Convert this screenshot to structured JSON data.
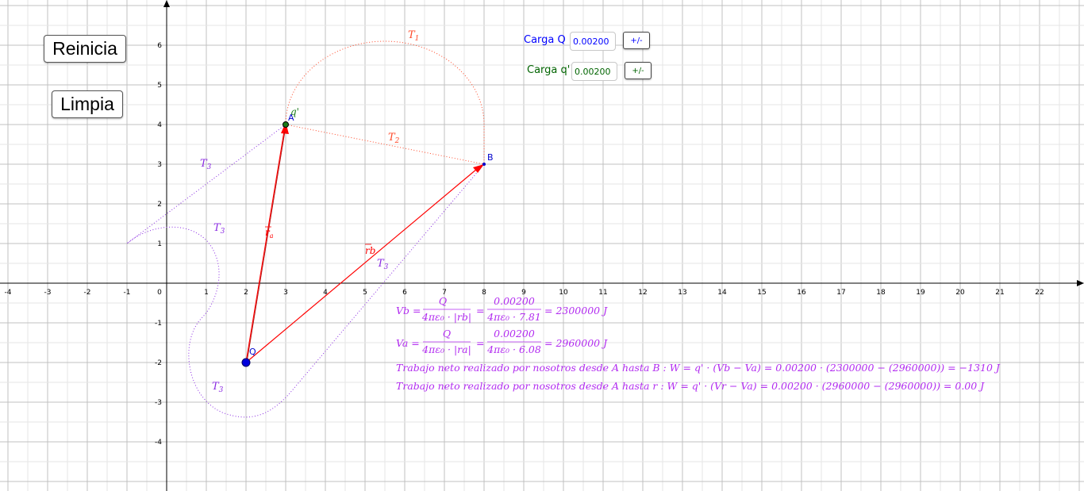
{
  "buttons": {
    "reinicia": "Reinicia",
    "limpia": "Limpia",
    "toggle_q": "+/-",
    "toggle_qprime": "+/-"
  },
  "controls": {
    "charge_q_label": "Carga Q",
    "charge_q_value": "0.00200",
    "charge_qprime_label": "Carga q'",
    "charge_qprime_value": "0.00200"
  },
  "axes": {
    "x_ticks": [
      "-4",
      "-3",
      "-2",
      "-1",
      "0",
      "1",
      "2",
      "3",
      "4",
      "5",
      "6",
      "7",
      "8",
      "9",
      "10",
      "11",
      "12",
      "13",
      "14",
      "15",
      "16",
      "17",
      "18",
      "19",
      "20",
      "21",
      "22"
    ],
    "y_ticks_pos": [
      "1",
      "2",
      "3",
      "4",
      "5",
      "6"
    ],
    "y_ticks_neg": [
      "-1",
      "-2",
      "-3",
      "-4"
    ]
  },
  "labels": {
    "t1": "T",
    "t1_sub": "1",
    "t2": "T",
    "t2_sub": "2",
    "t3": "T",
    "t3_sub": "3",
    "point_a": "A",
    "point_b": "B",
    "point_q": "Q",
    "qprime": "q'",
    "ra": "r",
    "ra_sub": "a",
    "rb": "rb"
  },
  "formulas": {
    "vb_lhs": "Vb =",
    "vb_num1": "Q",
    "vb_den1": "4πε₀ · |rb|",
    "vb_num2": "0.00200",
    "vb_den2": "4πε₀ · 7.81",
    "vb_result": "= 2300000 J",
    "va_lhs": "Va =",
    "va_num1": "Q",
    "va_den1": "4πε₀ · |ra|",
    "va_num2": "0.00200",
    "va_den2": "4πε₀ · 6.08",
    "va_result": "= 2960000 J",
    "work_ab": "Trabajo neto realizado por nosotros desde A hasta B :  W = q' · (Vb − Va) = 0.00200 · (2300000 − (2960000)) = −1310 J",
    "work_ar": "Trabajo neto realizado por nosotros desde A hasta r :  W = q' · (Vr − Va) = 0.00200 · (2960000 − (2960000)) = 0.00 J"
  },
  "colors": {
    "grid": "#c0c0c0",
    "vector": "#ff0000",
    "path_t1_t2": "#ff4a2a",
    "path_t3": "#8a2be2",
    "formula": "#b22cf0",
    "charge_q_label": "#0000ff",
    "charge_qprime_label": "#006400",
    "point": "#0000cc"
  }
}
